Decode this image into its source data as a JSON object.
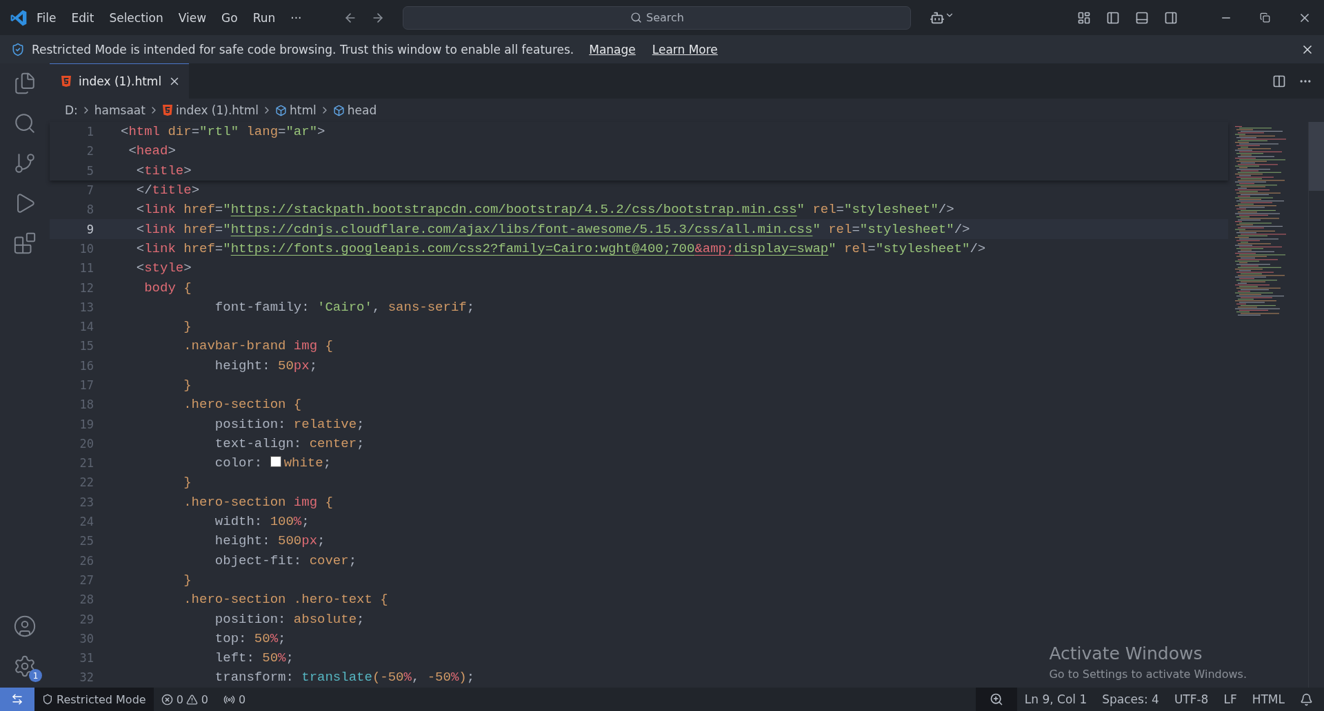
{
  "title_bar": {
    "menus": [
      "File",
      "Edit",
      "Selection",
      "View",
      "Go",
      "Run",
      "···"
    ],
    "search": {
      "placeholder": "Search"
    }
  },
  "banner": {
    "message": "Restricted Mode is intended for safe code browsing. Trust this window to enable all features.",
    "links": [
      "Manage",
      "Learn More"
    ]
  },
  "activity_bar": {
    "items": [
      {
        "kind": "files"
      },
      {
        "kind": "search"
      },
      {
        "kind": "source-control"
      },
      {
        "kind": "run"
      },
      {
        "kind": "extensions"
      }
    ],
    "bottom": [
      {
        "kind": "account"
      },
      {
        "kind": "settings",
        "badge": "1"
      }
    ]
  },
  "tabs": [
    {
      "label": "index (1).html",
      "selected": true
    }
  ],
  "breadcrumb": [
    {
      "label": "D:",
      "kind": "folder"
    },
    {
      "label": "hamsaat",
      "kind": "folder"
    },
    {
      "label": "index (1).html",
      "kind": "html-file"
    },
    {
      "label": "html",
      "kind": "element"
    },
    {
      "label": "head",
      "kind": "element"
    }
  ],
  "sticky_lines": [
    {
      "number": "1",
      "tokens": [
        {
          "text": "<",
          "kind": "punct"
        },
        {
          "text": "html",
          "kind": "tag"
        },
        {
          "text": " dir",
          "kind": "attr"
        },
        {
          "text": "=",
          "kind": "punct"
        },
        {
          "text": "\"rtl\"",
          "kind": "str"
        },
        {
          "text": " lang",
          "kind": "attr"
        },
        {
          "text": "=",
          "kind": "punct"
        },
        {
          "text": "\"ar\"",
          "kind": "str"
        },
        {
          "text": ">",
          "kind": "punct"
        }
      ]
    },
    {
      "number": "2",
      "tokens": [
        {
          "text": " <",
          "kind": "punct"
        },
        {
          "text": "head",
          "kind": "tag"
        },
        {
          "text": ">",
          "kind": "punct"
        }
      ]
    },
    {
      "number": "5",
      "tokens": [
        {
          "text": "  <",
          "kind": "punct"
        },
        {
          "text": "title",
          "kind": "tag"
        },
        {
          "text": ">",
          "kind": "punct"
        }
      ]
    }
  ],
  "lines": [
    {
      "number": "7",
      "current": false,
      "tokens": [
        {
          "text": "  </",
          "kind": "punct"
        },
        {
          "text": "title",
          "kind": "tag"
        },
        {
          "text": ">",
          "kind": "punct"
        }
      ]
    },
    {
      "number": "8",
      "current": false,
      "tokens": [
        {
          "text": "  <",
          "kind": "punct"
        },
        {
          "text": "link",
          "kind": "tag"
        },
        {
          "text": " href",
          "kind": "attr"
        },
        {
          "text": "=",
          "kind": "punct"
        },
        {
          "text": "\"",
          "kind": "str"
        },
        {
          "text": "https://stackpath.bootstrapcdn.com/bootstrap/4.5.2/css/bootstrap.min.css",
          "kind": "link"
        },
        {
          "text": "\"",
          "kind": "str"
        },
        {
          "text": " rel",
          "kind": "attr"
        },
        {
          "text": "=",
          "kind": "punct"
        },
        {
          "text": "\"stylesheet\"",
          "kind": "str"
        },
        {
          "text": "/>",
          "kind": "punct"
        }
      ]
    },
    {
      "number": "9",
      "current": true,
      "tokens": [
        {
          "text": "  <",
          "kind": "punct"
        },
        {
          "text": "link",
          "kind": "tag"
        },
        {
          "text": " href",
          "kind": "attr"
        },
        {
          "text": "=",
          "kind": "punct"
        },
        {
          "text": "\"",
          "kind": "str"
        },
        {
          "text": "https://cdnjs.cloudflare.com/ajax/libs/font-awesome/5.15.3/css/all.min.css",
          "kind": "link"
        },
        {
          "text": "\"",
          "kind": "str"
        },
        {
          "text": " rel",
          "kind": "attr"
        },
        {
          "text": "=",
          "kind": "punct"
        },
        {
          "text": "\"stylesheet\"",
          "kind": "str"
        },
        {
          "text": "/>",
          "kind": "punct"
        }
      ]
    },
    {
      "number": "10",
      "current": false,
      "tokens": [
        {
          "text": "  <",
          "kind": "punct"
        },
        {
          "text": "link",
          "kind": "tag"
        },
        {
          "text": " href",
          "kind": "attr"
        },
        {
          "text": "=",
          "kind": "punct"
        },
        {
          "text": "\"",
          "kind": "str"
        },
        {
          "text": "https://fonts.googleapis.com/css2?family=Cairo:wght@400;700",
          "kind": "link"
        },
        {
          "text": "&amp;",
          "kind": "entity"
        },
        {
          "text": "display=swap",
          "kind": "link"
        },
        {
          "text": "\"",
          "kind": "str"
        },
        {
          "text": " rel",
          "kind": "attr"
        },
        {
          "text": "=",
          "kind": "punct"
        },
        {
          "text": "\"stylesheet\"",
          "kind": "str"
        },
        {
          "text": "/>",
          "kind": "punct"
        }
      ]
    },
    {
      "number": "11",
      "current": false,
      "tokens": [
        {
          "text": "  <",
          "kind": "punct"
        },
        {
          "text": "style",
          "kind": "tag"
        },
        {
          "text": ">",
          "kind": "punct"
        }
      ]
    },
    {
      "number": "12",
      "current": false,
      "tokens": [
        {
          "text": "   body",
          "kind": "tag"
        },
        {
          "text": " {",
          "kind": "brace"
        }
      ]
    },
    {
      "number": "13",
      "current": false,
      "tokens": [
        {
          "text": "            font-family: ",
          "kind": "plain"
        },
        {
          "text": "'Cairo'",
          "kind": "str"
        },
        {
          "text": ", ",
          "kind": "plain"
        },
        {
          "text": "sans-serif",
          "kind": "value"
        },
        {
          "text": ";",
          "kind": "plain"
        }
      ]
    },
    {
      "number": "14",
      "current": false,
      "tokens": [
        {
          "text": "        }",
          "kind": "brace"
        }
      ]
    },
    {
      "number": "15",
      "current": false,
      "tokens": [
        {
          "text": "        .navbar-brand",
          "kind": "selector"
        },
        {
          "text": " img",
          "kind": "tag"
        },
        {
          "text": " {",
          "kind": "brace"
        }
      ]
    },
    {
      "number": "16",
      "current": false,
      "tokens": [
        {
          "text": "            height: ",
          "kind": "plain"
        },
        {
          "text": "50",
          "kind": "num"
        },
        {
          "text": "px",
          "kind": "unit"
        },
        {
          "text": ";",
          "kind": "plain"
        }
      ]
    },
    {
      "number": "17",
      "current": false,
      "tokens": [
        {
          "text": "        }",
          "kind": "brace"
        }
      ]
    },
    {
      "number": "18",
      "current": false,
      "tokens": [
        {
          "text": "        .hero-section",
          "kind": "selector"
        },
        {
          "text": " {",
          "kind": "brace"
        }
      ]
    },
    {
      "number": "19",
      "current": false,
      "tokens": [
        {
          "text": "            position: ",
          "kind": "plain"
        },
        {
          "text": "relative",
          "kind": "value"
        },
        {
          "text": ";",
          "kind": "plain"
        }
      ]
    },
    {
      "number": "20",
      "current": false,
      "tokens": [
        {
          "text": "            text-align: ",
          "kind": "plain"
        },
        {
          "text": "center",
          "kind": "value"
        },
        {
          "text": ";",
          "kind": "plain"
        }
      ]
    },
    {
      "number": "21",
      "current": false,
      "tokens": [
        {
          "text": "            color: ",
          "kind": "plain"
        },
        {
          "text": "white",
          "kind": "value",
          "color": "#ffffff"
        },
        {
          "text": ";",
          "kind": "plain"
        }
      ]
    },
    {
      "number": "22",
      "current": false,
      "tokens": [
        {
          "text": "        }",
          "kind": "brace"
        }
      ]
    },
    {
      "number": "23",
      "current": false,
      "tokens": [
        {
          "text": "        .hero-section",
          "kind": "selector"
        },
        {
          "text": " img",
          "kind": "tag"
        },
        {
          "text": " {",
          "kind": "brace"
        }
      ]
    },
    {
      "number": "24",
      "current": false,
      "tokens": [
        {
          "text": "            width: ",
          "kind": "plain"
        },
        {
          "text": "100",
          "kind": "num"
        },
        {
          "text": "%",
          "kind": "unit"
        },
        {
          "text": ";",
          "kind": "plain"
        }
      ]
    },
    {
      "number": "25",
      "current": false,
      "tokens": [
        {
          "text": "            height: ",
          "kind": "plain"
        },
        {
          "text": "500",
          "kind": "num"
        },
        {
          "text": "px",
          "kind": "unit"
        },
        {
          "text": ";",
          "kind": "plain"
        }
      ]
    },
    {
      "number": "26",
      "current": false,
      "tokens": [
        {
          "text": "            object-fit: ",
          "kind": "plain"
        },
        {
          "text": "cover",
          "kind": "value"
        },
        {
          "text": ";",
          "kind": "plain"
        }
      ]
    },
    {
      "number": "27",
      "current": false,
      "tokens": [
        {
          "text": "        }",
          "kind": "brace"
        }
      ]
    },
    {
      "number": "28",
      "current": false,
      "tokens": [
        {
          "text": "        .hero-section .hero-text",
          "kind": "selector"
        },
        {
          "text": " {",
          "kind": "brace"
        }
      ]
    },
    {
      "number": "29",
      "current": false,
      "tokens": [
        {
          "text": "            position: ",
          "kind": "plain"
        },
        {
          "text": "absolute",
          "kind": "value"
        },
        {
          "text": ";",
          "kind": "plain"
        }
      ]
    },
    {
      "number": "30",
      "current": false,
      "tokens": [
        {
          "text": "            top: ",
          "kind": "plain"
        },
        {
          "text": "50",
          "kind": "num"
        },
        {
          "text": "%",
          "kind": "unit"
        },
        {
          "text": ";",
          "kind": "plain"
        }
      ]
    },
    {
      "number": "31",
      "current": false,
      "tokens": [
        {
          "text": "            left: ",
          "kind": "plain"
        },
        {
          "text": "50",
          "kind": "num"
        },
        {
          "text": "%",
          "kind": "unit"
        },
        {
          "text": ";",
          "kind": "plain"
        }
      ]
    },
    {
      "number": "32",
      "current": false,
      "tokens": [
        {
          "text": "            transform: ",
          "kind": "plain"
        },
        {
          "text": "translate",
          "kind": "func"
        },
        {
          "text": "(",
          "kind": "brace"
        },
        {
          "text": "-50",
          "kind": "num"
        },
        {
          "text": "%",
          "kind": "unit"
        },
        {
          "text": ", ",
          "kind": "plain"
        },
        {
          "text": "-50",
          "kind": "num"
        },
        {
          "text": "%",
          "kind": "unit"
        },
        {
          "text": ")",
          "kind": "brace"
        },
        {
          "text": ";",
          "kind": "plain"
        }
      ]
    }
  ],
  "activation": {
    "title": "Activate Windows",
    "subtitle": "Go to Settings to activate Windows."
  },
  "status_bar": {
    "left": [
      {
        "kind": "remote"
      },
      {
        "kind": "restricted",
        "label": "Restricted Mode"
      },
      {
        "kind": "problems",
        "errors": "0",
        "warnings": "0"
      },
      {
        "kind": "ports",
        "label": "0"
      }
    ],
    "right": [
      {
        "kind": "zoom"
      },
      {
        "kind": "text",
        "label": "Ln 9, Col 1"
      },
      {
        "kind": "text",
        "label": "Spaces: 4"
      },
      {
        "kind": "text",
        "label": "UTF-8"
      },
      {
        "kind": "text",
        "label": "LF"
      },
      {
        "kind": "text",
        "label": "HTML"
      },
      {
        "kind": "bell"
      }
    ]
  }
}
